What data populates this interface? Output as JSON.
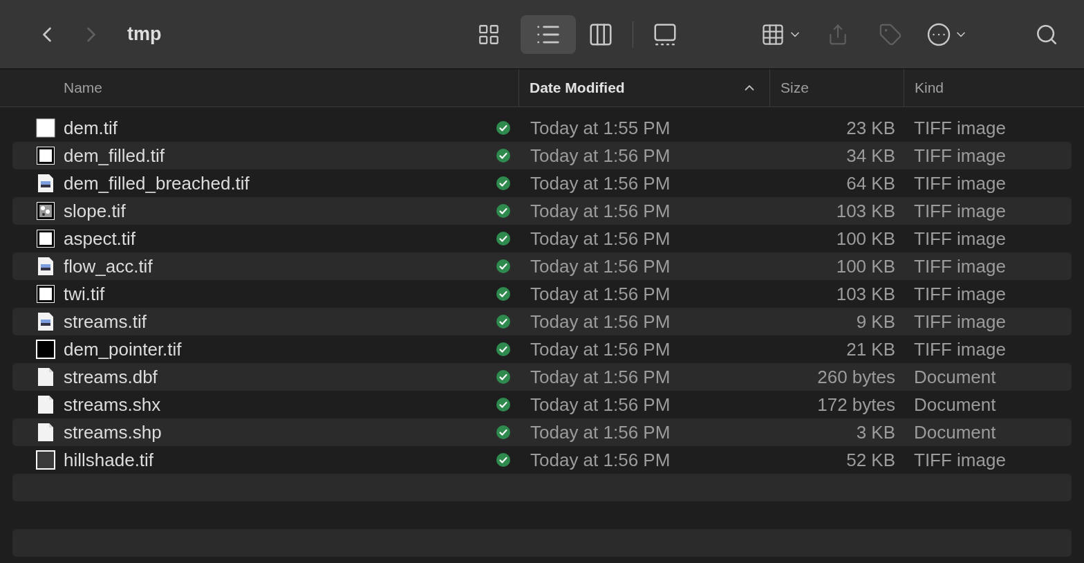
{
  "toolbar": {
    "title": "tmp",
    "nav": [
      {
        "kind": "back",
        "disabled": false
      },
      {
        "kind": "forward",
        "disabled": true
      }
    ],
    "views": [
      {
        "kind": "icons",
        "selected": false
      },
      {
        "kind": "list",
        "selected": true
      },
      {
        "kind": "columns",
        "selected": false
      },
      {
        "kind": "gallery",
        "selected": false
      }
    ],
    "actions": [
      {
        "kind": "group",
        "disabled": false
      },
      {
        "kind": "share",
        "disabled": true
      },
      {
        "kind": "tag",
        "disabled": true
      },
      {
        "kind": "more",
        "disabled": false
      }
    ]
  },
  "columns": [
    {
      "label": "Name",
      "sorted": false
    },
    {
      "label": "Date Modified",
      "sorted": true
    },
    {
      "label": "Size",
      "sorted": false
    },
    {
      "label": "Kind",
      "sorted": false
    }
  ],
  "rows": [
    {
      "name": "dem.tif",
      "kind": "blank",
      "synced": true,
      "date": "Today at 1:55 PM",
      "size": "23 KB",
      "file_type": "TIFF image"
    },
    {
      "name": "dem_filled.tif",
      "kind": "framed",
      "synced": true,
      "date": "Today at 1:56 PM",
      "size": "34 KB",
      "file_type": "TIFF image"
    },
    {
      "name": "dem_filled_breached.tif",
      "kind": "preview",
      "synced": true,
      "date": "Today at 1:56 PM",
      "size": "64 KB",
      "file_type": "TIFF image"
    },
    {
      "name": "slope.tif",
      "kind": "speckled",
      "synced": true,
      "date": "Today at 1:56 PM",
      "size": "103 KB",
      "file_type": "TIFF image"
    },
    {
      "name": "aspect.tif",
      "kind": "framed",
      "synced": true,
      "date": "Today at 1:56 PM",
      "size": "100 KB",
      "file_type": "TIFF image"
    },
    {
      "name": "flow_acc.tif",
      "kind": "preview",
      "synced": true,
      "date": "Today at 1:56 PM",
      "size": "100 KB",
      "file_type": "TIFF image"
    },
    {
      "name": "twi.tif",
      "kind": "framed",
      "synced": true,
      "date": "Today at 1:56 PM",
      "size": "103 KB",
      "file_type": "TIFF image"
    },
    {
      "name": "streams.tif",
      "kind": "preview",
      "synced": true,
      "date": "Today at 1:56 PM",
      "size": "9 KB",
      "file_type": "TIFF image"
    },
    {
      "name": "dem_pointer.tif",
      "kind": "black",
      "synced": true,
      "date": "Today at 1:56 PM",
      "size": "21 KB",
      "file_type": "TIFF image"
    },
    {
      "name": "streams.dbf",
      "kind": "document",
      "synced": true,
      "date": "Today at 1:56 PM",
      "size": "260 bytes",
      "file_type": "Document"
    },
    {
      "name": "streams.shx",
      "kind": "document",
      "synced": true,
      "date": "Today at 1:56 PM",
      "size": "172 bytes",
      "file_type": "Document"
    },
    {
      "name": "streams.shp",
      "kind": "document",
      "synced": true,
      "date": "Today at 1:56 PM",
      "size": "3 KB",
      "file_type": "Document"
    },
    {
      "name": "hillshade.tif",
      "kind": "dark",
      "synced": true,
      "date": "Today at 1:56 PM",
      "size": "52 KB",
      "file_type": "TIFF image"
    }
  ]
}
